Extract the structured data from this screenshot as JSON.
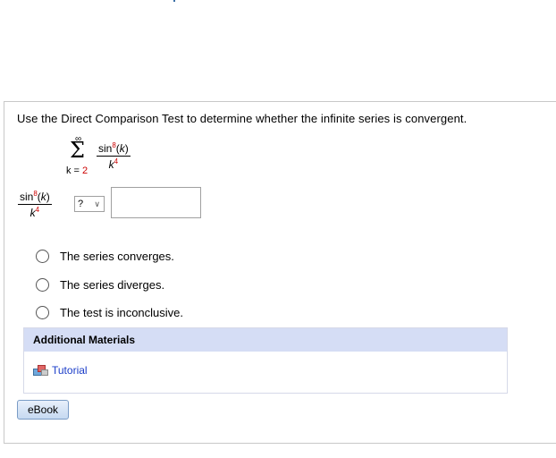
{
  "question": {
    "text": "Use the Direct Comparison Test to determine whether the infinite series is convergent."
  },
  "series": {
    "upper_limit": "∞",
    "sigma": "Σ",
    "index_var": "k",
    "index_eq": " = ",
    "index_start": "2",
    "numerator_fn": "sin",
    "numerator_power": "8",
    "numerator_open": "(",
    "numerator_arg": "k",
    "numerator_close": ")",
    "denominator_base": "k",
    "denominator_power": "4"
  },
  "comparison": {
    "select_value": "?",
    "answer_value": ""
  },
  "choices": [
    {
      "label": "The series converges."
    },
    {
      "label": "The series diverges."
    },
    {
      "label": "The test is inconclusive."
    }
  ],
  "materials": {
    "title": "Additional Materials",
    "tutorial_label": "Tutorial",
    "tutorial_icon": "tutorial-blocks-icon"
  },
  "ebook": {
    "label": "eBook"
  },
  "colors": {
    "accent_red": "#cc0000",
    "link_blue": "#1a3cc8",
    "materials_header": "#d5ddf5"
  }
}
